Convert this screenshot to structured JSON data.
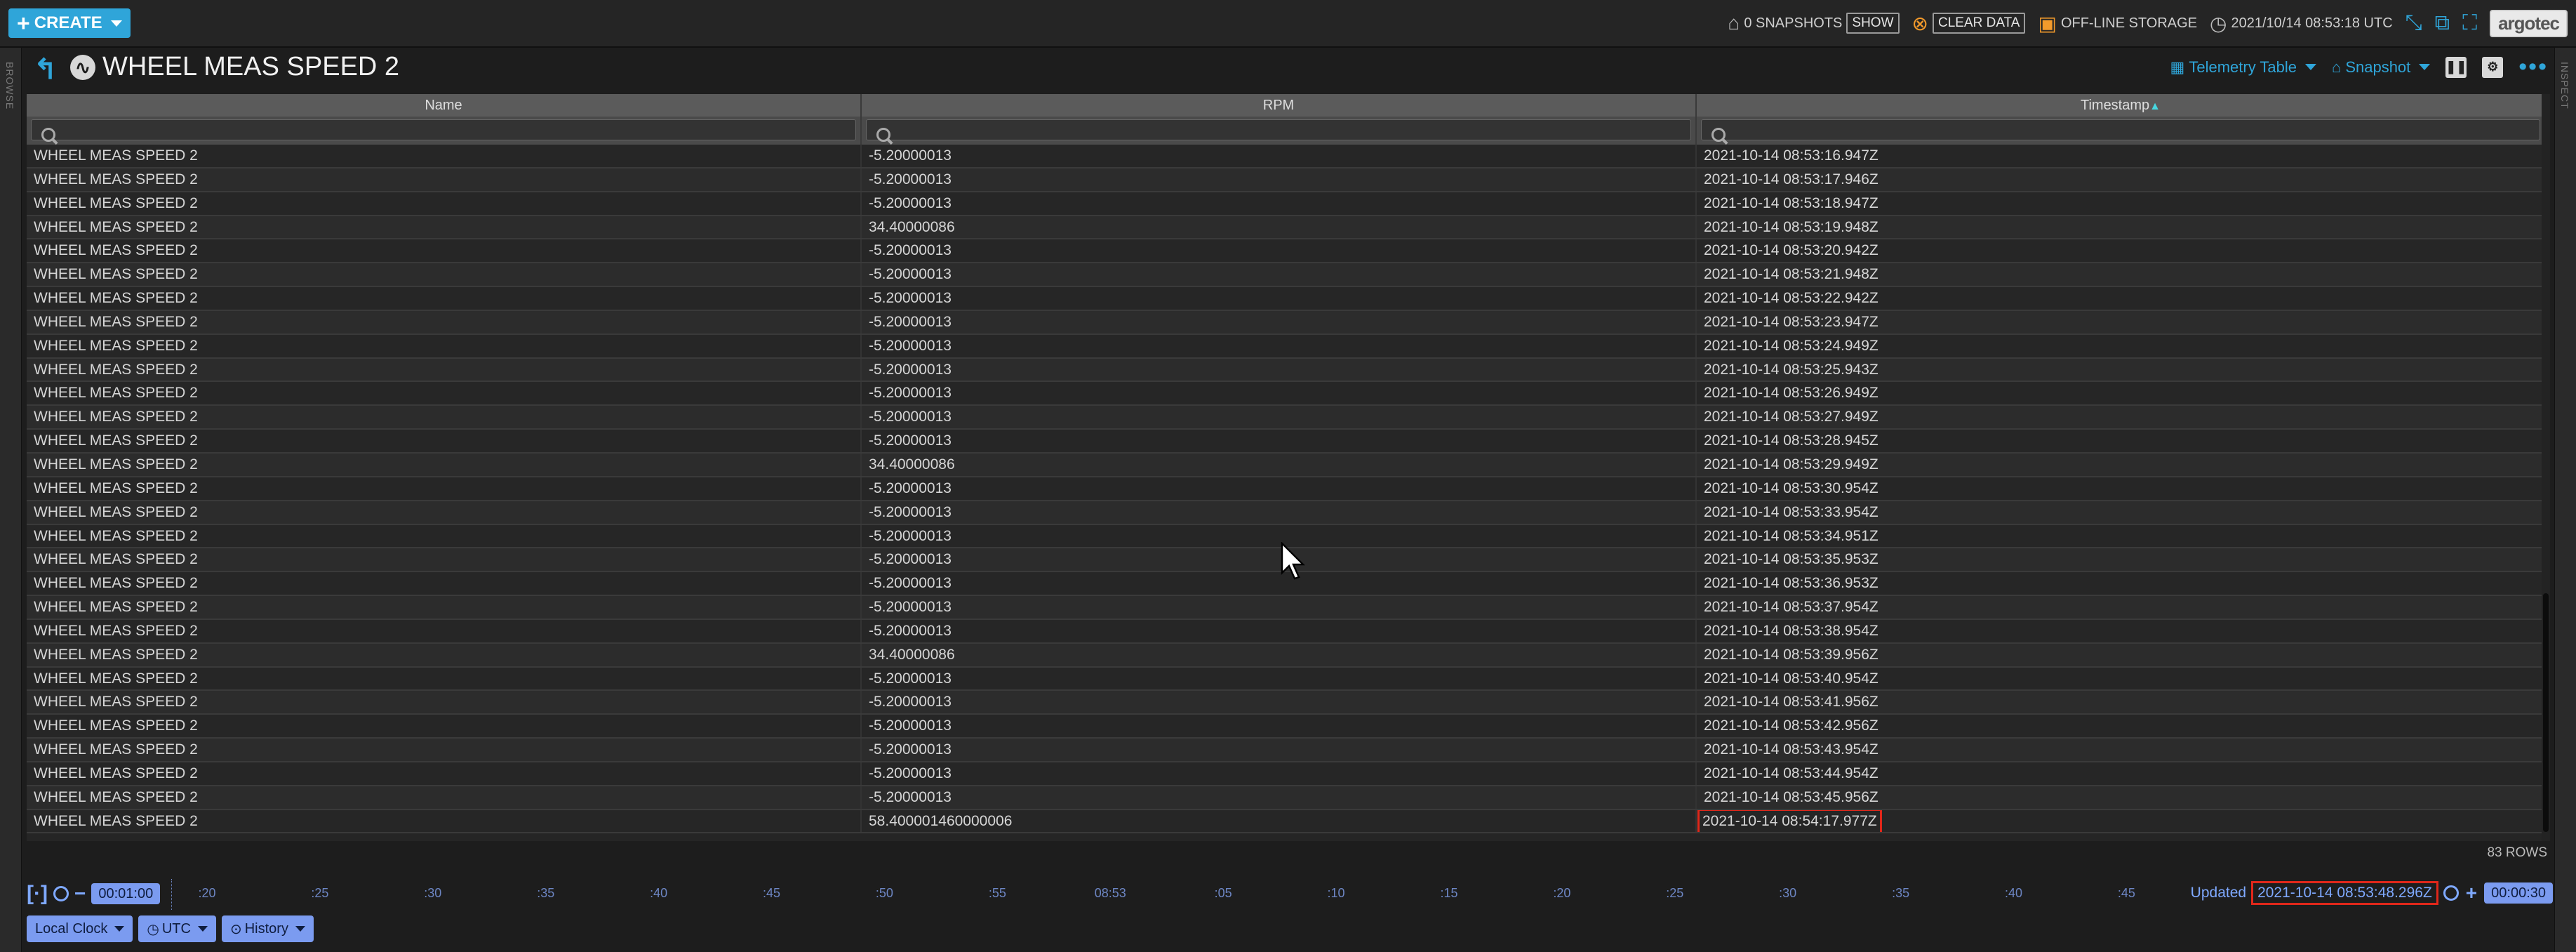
{
  "topbar": {
    "create_label": "CREATE",
    "snapshots_label": "0 SNAPSHOTS",
    "show_label": "SHOW",
    "clear_data_label": "CLEAR DATA",
    "offline_storage_label": "OFF-LINE STORAGE",
    "clock_value": "2021/10/14 08:53:18 UTC",
    "brand": "argotec"
  },
  "sidebars": {
    "left_label": "BROWSE",
    "right_label": "INSPECT"
  },
  "object": {
    "title": "WHEEL MEAS SPEED 2",
    "view_label": "Telemetry Table",
    "snapshot_label": "Snapshot"
  },
  "table": {
    "columns": [
      {
        "label": "Name",
        "sort": ""
      },
      {
        "label": "RPM",
        "sort": ""
      },
      {
        "label": "Timestamp",
        "sort": "▲"
      }
    ],
    "rows": [
      [
        "WHEEL MEAS SPEED 2",
        "-5.20000013",
        "2021-10-14 08:53:16.947Z"
      ],
      [
        "WHEEL MEAS SPEED 2",
        "-5.20000013",
        "2021-10-14 08:53:17.946Z"
      ],
      [
        "WHEEL MEAS SPEED 2",
        "-5.20000013",
        "2021-10-14 08:53:18.947Z"
      ],
      [
        "WHEEL MEAS SPEED 2",
        "34.40000086",
        "2021-10-14 08:53:19.948Z"
      ],
      [
        "WHEEL MEAS SPEED 2",
        "-5.20000013",
        "2021-10-14 08:53:20.942Z"
      ],
      [
        "WHEEL MEAS SPEED 2",
        "-5.20000013",
        "2021-10-14 08:53:21.948Z"
      ],
      [
        "WHEEL MEAS SPEED 2",
        "-5.20000013",
        "2021-10-14 08:53:22.942Z"
      ],
      [
        "WHEEL MEAS SPEED 2",
        "-5.20000013",
        "2021-10-14 08:53:23.947Z"
      ],
      [
        "WHEEL MEAS SPEED 2",
        "-5.20000013",
        "2021-10-14 08:53:24.949Z"
      ],
      [
        "WHEEL MEAS SPEED 2",
        "-5.20000013",
        "2021-10-14 08:53:25.943Z"
      ],
      [
        "WHEEL MEAS SPEED 2",
        "-5.20000013",
        "2021-10-14 08:53:26.949Z"
      ],
      [
        "WHEEL MEAS SPEED 2",
        "-5.20000013",
        "2021-10-14 08:53:27.949Z"
      ],
      [
        "WHEEL MEAS SPEED 2",
        "-5.20000013",
        "2021-10-14 08:53:28.945Z"
      ],
      [
        "WHEEL MEAS SPEED 2",
        "34.40000086",
        "2021-10-14 08:53:29.949Z"
      ],
      [
        "WHEEL MEAS SPEED 2",
        "-5.20000013",
        "2021-10-14 08:53:30.954Z"
      ],
      [
        "WHEEL MEAS SPEED 2",
        "-5.20000013",
        "2021-10-14 08:53:33.954Z"
      ],
      [
        "WHEEL MEAS SPEED 2",
        "-5.20000013",
        "2021-10-14 08:53:34.951Z"
      ],
      [
        "WHEEL MEAS SPEED 2",
        "-5.20000013",
        "2021-10-14 08:53:35.953Z"
      ],
      [
        "WHEEL MEAS SPEED 2",
        "-5.20000013",
        "2021-10-14 08:53:36.953Z"
      ],
      [
        "WHEEL MEAS SPEED 2",
        "-5.20000013",
        "2021-10-14 08:53:37.954Z"
      ],
      [
        "WHEEL MEAS SPEED 2",
        "-5.20000013",
        "2021-10-14 08:53:38.954Z"
      ],
      [
        "WHEEL MEAS SPEED 2",
        "34.40000086",
        "2021-10-14 08:53:39.956Z"
      ],
      [
        "WHEEL MEAS SPEED 2",
        "-5.20000013",
        "2021-10-14 08:53:40.954Z"
      ],
      [
        "WHEEL MEAS SPEED 2",
        "-5.20000013",
        "2021-10-14 08:53:41.956Z"
      ],
      [
        "WHEEL MEAS SPEED 2",
        "-5.20000013",
        "2021-10-14 08:53:42.956Z"
      ],
      [
        "WHEEL MEAS SPEED 2",
        "-5.20000013",
        "2021-10-14 08:53:43.954Z"
      ],
      [
        "WHEEL MEAS SPEED 2",
        "-5.20000013",
        "2021-10-14 08:53:44.954Z"
      ],
      [
        "WHEEL MEAS SPEED 2",
        "-5.20000013",
        "2021-10-14 08:53:45.956Z"
      ],
      [
        "WHEEL MEAS SPEED 2",
        "58.400001460000006",
        "2021-10-14 08:54:17.977Z"
      ]
    ],
    "highlighted_row": 28,
    "row_count": "83 ROWS"
  },
  "time_conductor": {
    "start_offset": "00:01:00",
    "end_offset": "00:00:30",
    "ticks": [
      ":20",
      ":25",
      ":30",
      ":35",
      ":40",
      ":45",
      ":50",
      ":55",
      "08:53",
      ":05",
      ":10",
      ":15",
      ":20",
      ":25",
      ":30",
      ":35",
      ":40",
      ":45"
    ],
    "updated_label": "Updated",
    "updated_value": "2021-10-14 08:53:48.296Z",
    "clock_label": "Local Clock",
    "timesystem_label": "UTC",
    "mode_label": "History"
  },
  "colors": {
    "accent": "#2fa5d9",
    "conductor": "#7b9bf0",
    "highlight": "#e0271a",
    "sort": "#47d7e0"
  }
}
